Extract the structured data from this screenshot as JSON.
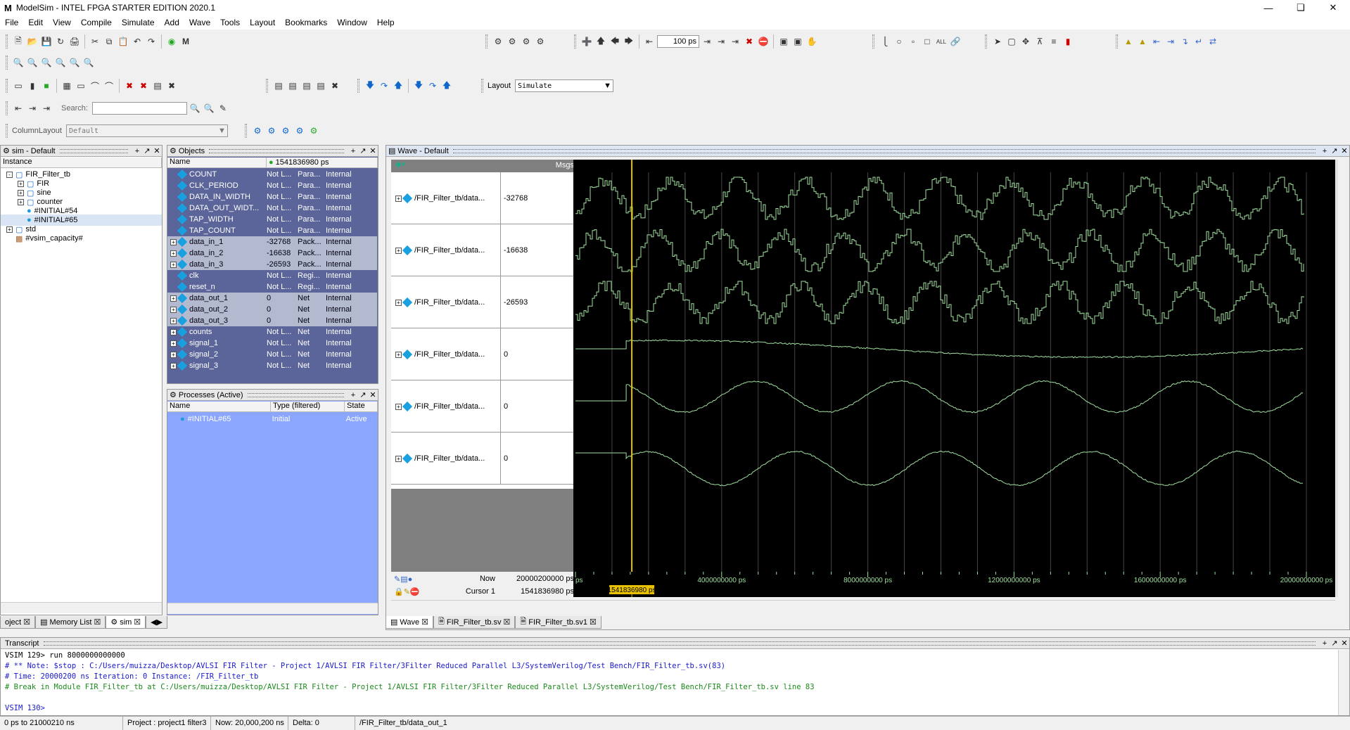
{
  "app": {
    "title": "ModelSim - INTEL FPGA STARTER EDITION 2020.1",
    "logo": "M"
  },
  "menu": [
    "File",
    "Edit",
    "View",
    "Compile",
    "Simulate",
    "Add",
    "Wave",
    "Tools",
    "Layout",
    "Bookmarks",
    "Window",
    "Help"
  ],
  "toolbar": {
    "run_length": "100 ps",
    "search_label": "Search:",
    "layout_label": "Layout",
    "layout_value": "Simulate",
    "column_layout_label": "ColumnLayout",
    "column_layout_value": "Default"
  },
  "sim_panel": {
    "title": "sim - Default",
    "column": "Instance",
    "items": [
      {
        "label": "FIR_Filter_tb",
        "level": 0,
        "kind": "module",
        "expand": "-"
      },
      {
        "label": "FIR",
        "level": 1,
        "kind": "module",
        "expand": "+"
      },
      {
        "label": "sine",
        "level": 1,
        "kind": "module",
        "expand": "+"
      },
      {
        "label": "counter",
        "level": 1,
        "kind": "module",
        "expand": "+"
      },
      {
        "label": "#INITIAL#54",
        "level": 1,
        "kind": "process",
        "expand": ""
      },
      {
        "label": "#INITIAL#65",
        "level": 1,
        "kind": "process",
        "expand": "",
        "selected": true
      },
      {
        "label": "std",
        "level": 0,
        "kind": "module",
        "expand": "+"
      },
      {
        "label": "#vsim_capacity#",
        "level": 0,
        "kind": "capacity",
        "expand": ""
      }
    ]
  },
  "objects_panel": {
    "title": "Objects",
    "time": "1541836980 ps",
    "columns": [
      "Name",
      "",
      "",
      ""
    ],
    "rows": [
      {
        "name": "COUNT",
        "value": "Not L...",
        "kind": "Para...",
        "mode": "Internal",
        "expand": false,
        "sel": false
      },
      {
        "name": "CLK_PERIOD",
        "value": "Not L...",
        "kind": "Para...",
        "mode": "Internal",
        "expand": false,
        "sel": false
      },
      {
        "name": "DATA_IN_WIDTH",
        "value": "Not L...",
        "kind": "Para...",
        "mode": "Internal",
        "expand": false,
        "sel": false
      },
      {
        "name": "DATA_OUT_WIDT...",
        "value": "Not L...",
        "kind": "Para...",
        "mode": "Internal",
        "expand": false,
        "sel": false
      },
      {
        "name": "TAP_WIDTH",
        "value": "Not L...",
        "kind": "Para...",
        "mode": "Internal",
        "expand": false,
        "sel": false
      },
      {
        "name": "TAP_COUNT",
        "value": "Not L...",
        "kind": "Para...",
        "mode": "Internal",
        "expand": false,
        "sel": false
      },
      {
        "name": "data_in_1",
        "value": "-32768",
        "kind": "Pack...",
        "mode": "Internal",
        "expand": true,
        "sel": true
      },
      {
        "name": "data_in_2",
        "value": "-16638",
        "kind": "Pack...",
        "mode": "Internal",
        "expand": true,
        "sel": true
      },
      {
        "name": "data_in_3",
        "value": "-26593",
        "kind": "Pack...",
        "mode": "Internal",
        "expand": true,
        "sel": true
      },
      {
        "name": "clk",
        "value": "Not L...",
        "kind": "Regi...",
        "mode": "Internal",
        "expand": false,
        "sel": false
      },
      {
        "name": "reset_n",
        "value": "Not L...",
        "kind": "Regi...",
        "mode": "Internal",
        "expand": false,
        "sel": false
      },
      {
        "name": "data_out_1",
        "value": "0",
        "kind": "Net",
        "mode": "Internal",
        "expand": true,
        "sel": true
      },
      {
        "name": "data_out_2",
        "value": "0",
        "kind": "Net",
        "mode": "Internal",
        "expand": true,
        "sel": true
      },
      {
        "name": "data_out_3",
        "value": "0",
        "kind": "Net",
        "mode": "Internal",
        "expand": true,
        "sel": true
      },
      {
        "name": "counts",
        "value": "Not L...",
        "kind": "Net",
        "mode": "Internal",
        "expand": true,
        "sel": false
      },
      {
        "name": "signal_1",
        "value": "Not L...",
        "kind": "Net",
        "mode": "Internal",
        "expand": true,
        "sel": false
      },
      {
        "name": "signal_2",
        "value": "Not L...",
        "kind": "Net",
        "mode": "Internal",
        "expand": true,
        "sel": false
      },
      {
        "name": "signal_3",
        "value": "Not L...",
        "kind": "Net",
        "mode": "Internal",
        "expand": true,
        "sel": false
      }
    ]
  },
  "processes_panel": {
    "title": "Processes (Active)",
    "columns": [
      "Name",
      "Type (filtered)",
      "State"
    ],
    "rows": [
      {
        "name": "#INITIAL#65",
        "type": "Initial",
        "state": "Active"
      }
    ]
  },
  "left_tabs": [
    "oject",
    "Memory List",
    "sim"
  ],
  "wave": {
    "title": "Wave - Default",
    "msgs_label": "Msgs",
    "signals": [
      {
        "name": "/FIR_Filter_tb/data...",
        "value": "-32768"
      },
      {
        "name": "/FIR_Filter_tb/data...",
        "value": "-16638"
      },
      {
        "name": "/FIR_Filter_tb/data...",
        "value": "-26593"
      },
      {
        "name": "/FIR_Filter_tb/data...",
        "value": "0"
      },
      {
        "name": "/FIR_Filter_tb/data...",
        "value": "0"
      },
      {
        "name": "/FIR_Filter_tb/data...",
        "value": "0"
      }
    ],
    "now_label": "Now",
    "now_value": "20000200000 ps",
    "cursor_label": "Cursor 1",
    "cursor_value": "1541836980 ps",
    "cursor_flag": "1541836980 ps",
    "timeline_start": "ps",
    "timeline_labels": [
      "4000000000 ps",
      "8000000000 ps",
      "12000000000 ps",
      "16000000000 ps",
      "20000000000 ps"
    ],
    "tabs": [
      "Wave",
      "FIR_Filter_tb.sv",
      "FIR_Filter_tb.sv1"
    ]
  },
  "transcript": {
    "title": "Transcript",
    "lines": [
      {
        "text": "VSIM 129> run 8000000000000",
        "color": "#000000"
      },
      {
        "text": "# ** Note: $stop    : C:/Users/muizza/Desktop/AVLSI FIR Filter - Project 1/AVLSI FIR Filter/3Filter Reduced Parallel L3/SystemVerilog/Test Bench/FIR_Filter_tb.sv(83)",
        "color": "#1a1acc"
      },
      {
        "text": "#    Time: 20000200 ns  Iteration: 0  Instance: /FIR_Filter_tb",
        "color": "#1a1acc"
      },
      {
        "text": "# Break in Module FIR_Filter_tb at C:/Users/muizza/Desktop/AVLSI FIR Filter - Project 1/AVLSI FIR Filter/3Filter Reduced Parallel L3/SystemVerilog/Test Bench/FIR_Filter_tb.sv line 83",
        "color": "#1a8a1a"
      },
      {
        "text": "",
        "color": "#000000"
      },
      {
        "text": "VSIM 130>",
        "color": "#1a1acc"
      }
    ]
  },
  "status": [
    "0 ps to 21000210 ns",
    "Project : project1 filter3",
    "Now: 20,000,200 ns",
    "Delta: 0",
    "/FIR_Filter_tb/data_out_1"
  ],
  "colors": {
    "wave": "#9fe09f",
    "cursor": "#e8c100",
    "selection": "#5b6599",
    "process_bg": "#8aa6ff"
  }
}
